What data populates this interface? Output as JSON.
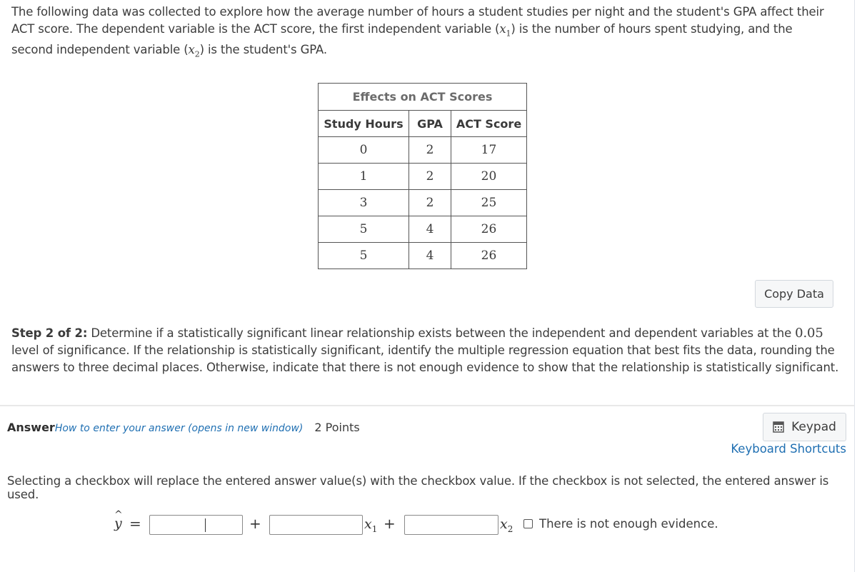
{
  "intro": {
    "text_before_x1": "The following data was collected to explore how the average number of hours a student studies per night and the student's GPA affect their ACT score. The dependent variable is the ACT score, the first independent variable (",
    "x1": "x",
    "x1_sub": "1",
    "text_between": ") is the number of hours spent studying, and the second independent variable (",
    "x2": "x",
    "x2_sub": "2",
    "text_after": ") is the student's GPA."
  },
  "table": {
    "caption": "Effects on ACT Scores",
    "headers": [
      "Study Hours",
      "GPA",
      "ACT Score"
    ],
    "rows": [
      [
        "0",
        "2",
        "17"
      ],
      [
        "1",
        "2",
        "20"
      ],
      [
        "3",
        "2",
        "25"
      ],
      [
        "5",
        "4",
        "26"
      ],
      [
        "5",
        "4",
        "26"
      ]
    ]
  },
  "copy_data_label": "Copy Data",
  "step": {
    "label": "Step 2 of 2:",
    "text_before_level": " Determine if a statistically significant linear relationship exists between the independent and dependent variables at the ",
    "level": "0.05",
    "text_after_level": " level of significance. If the relationship is statistically significant, identify the multiple regression equation that best fits the data, rounding the answers to three decimal places. Otherwise, indicate that there is not enough evidence to show that the relationship is statistically significant."
  },
  "answer": {
    "label": "Answer",
    "howto_link": "How to enter your answer (opens in new window)",
    "points": "2 Points",
    "keypad_label": "Keypad",
    "keyboard_shortcuts": "Keyboard Shortcuts",
    "note": "Selecting a checkbox will replace the entered answer value(s) with the checkbox value. If the checkbox is not selected, the entered answer is used.",
    "equation": {
      "yhat": "y",
      "hat": "^",
      "equals": "=",
      "plus1": "+",
      "x1": "x",
      "x1_sub": "1",
      "plus2": "+",
      "x2": "x",
      "x2_sub": "2",
      "intercept_value": "",
      "b1_value": "",
      "b2_value": ""
    },
    "checkbox_label": "There is not enough evidence.",
    "checkbox_checked": false
  }
}
